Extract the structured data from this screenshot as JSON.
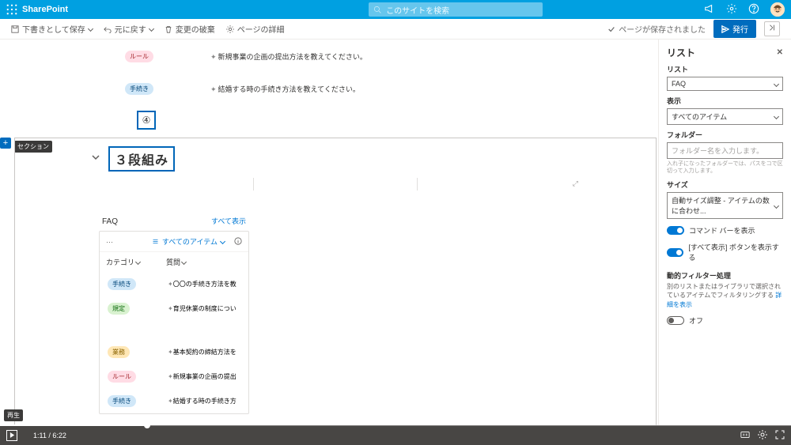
{
  "colors": {
    "brand": "#00a0e1",
    "primary": "#006cbe",
    "link": "#0078d4"
  },
  "topbar": {
    "app": "SharePoint",
    "search_placeholder": "このサイトを検索"
  },
  "editbar": {
    "save_draft": "下書きとして保存",
    "undo": "元に戻す",
    "discard": "変更の破棄",
    "page_details": "ページの詳細",
    "saved_msg": "ページが保存されました",
    "publish": "発行"
  },
  "canvas": {
    "top_rows": [
      {
        "badge": "ルール",
        "badge_class": "b-rule",
        "text": "新規事業の企画の提出方法を教えてください。"
      },
      {
        "badge": "手続き",
        "badge_class": "b-proc",
        "text": "結婚する時の手続き方法を教えてください。"
      }
    ],
    "marker4": "④",
    "add_section_label": "セクション",
    "section_title": "３段組み"
  },
  "faq": {
    "title": "FAQ",
    "show_all": "すべて表示",
    "views_label": "すべてのアイテム",
    "col_cat": "カテゴリ",
    "col_q": "質問",
    "rows": [
      {
        "badge": "手続き",
        "badge_class": "b-proc",
        "text": "〇〇の手続き方法を教"
      },
      {
        "badge": "規定",
        "badge_class": "b-reg",
        "text": "育児休業の制度につい"
      },
      {
        "badge": "業務",
        "badge_class": "b-other",
        "text": "基本契約の締結方法を"
      },
      {
        "badge": "ルール",
        "badge_class": "b-rule",
        "text": "新規事業の企画の提出"
      },
      {
        "badge": "手続き",
        "badge_class": "b-proc",
        "text": "結婚する時の手続き方"
      }
    ]
  },
  "panel": {
    "heading": "リスト",
    "list_label": "リスト",
    "list_value": "FAQ",
    "view_label": "表示",
    "view_value": "すべてのアイテム",
    "folder_label": "フォルダー",
    "folder_placeholder": "フォルダー名を入力します。",
    "folder_hint": "入れ子になったフォルダーでは、パスをコで区切って入力します。",
    "size_label": "サイズ",
    "size_value": "自動サイズ調整 - アイテムの数に合わせ...",
    "toggle_cmdbar": "コマンド バーを表示",
    "toggle_showall": "[すべて表示] ボタンを表示する",
    "dynfilter_title": "動的フィルター処理",
    "dynfilter_desc_a": "別のリストまたはライブラリで選択されているアイテムでフィルタリングする ",
    "dynfilter_link": "詳細を表示",
    "toggle_off": "オフ"
  },
  "video": {
    "replay": "再生",
    "time": "1:11 / 6:22",
    "progress_pct": 18.6
  }
}
